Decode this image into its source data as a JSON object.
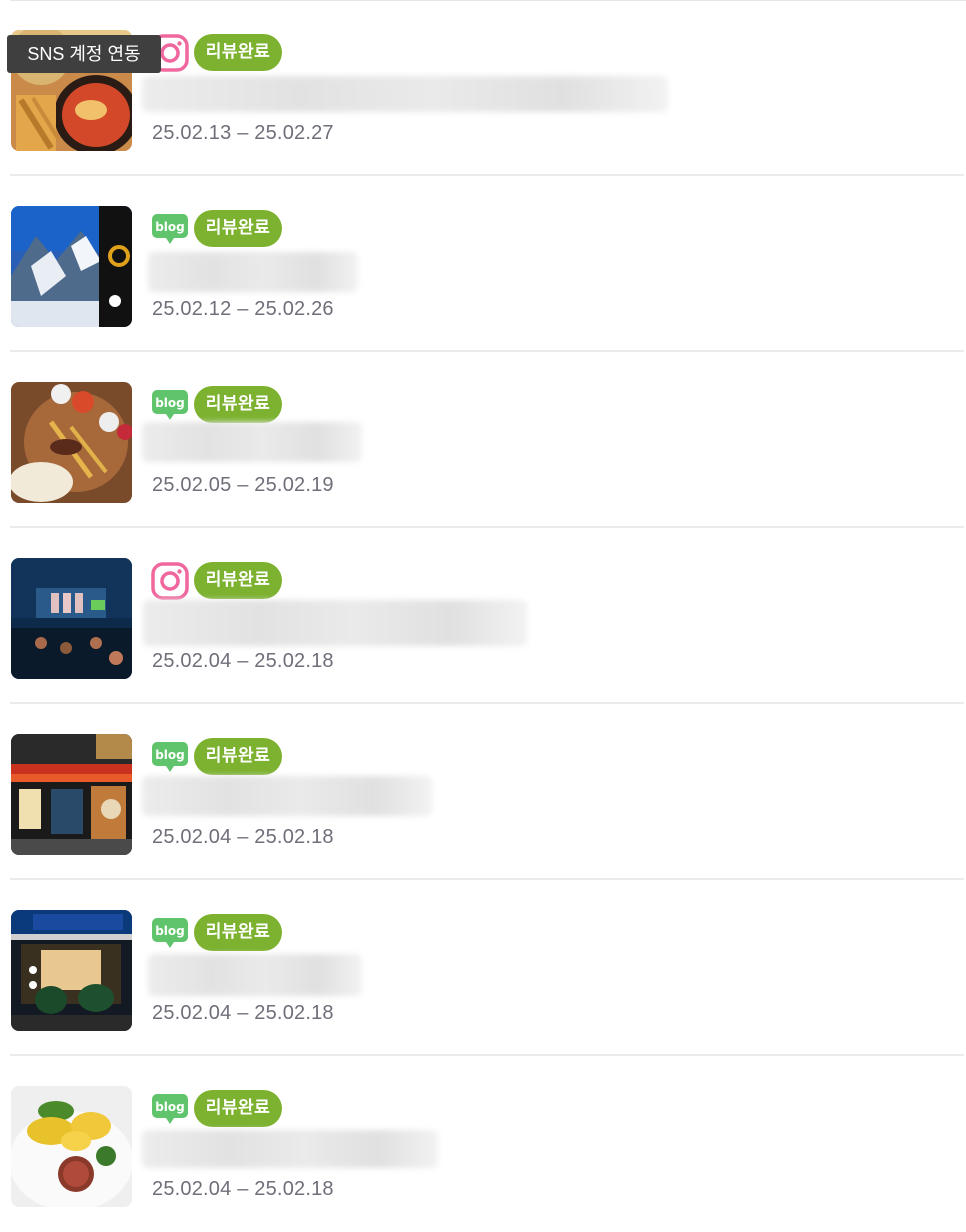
{
  "tooltip": {
    "text": "SNS 계정 연동"
  },
  "badge_label": "리뷰완료",
  "icons": {
    "instagram": "instagram-icon",
    "blog": "naver-blog-icon"
  },
  "colors": {
    "badge_bg": "#7cb22f",
    "instagram_pink": "#f0679e",
    "blog_green": "#5fc46b",
    "date_text": "#6f6f7a",
    "tooltip_bg": "#3f3f3f"
  },
  "blog_icon_text": "blog",
  "items": [
    {
      "sns": "instagram",
      "status": "리뷰완료",
      "date_range": "25.02.13 – 25.02.27",
      "thumbnail": "food-stew-image"
    },
    {
      "sns": "blog",
      "status": "리뷰완료",
      "date_range": "25.02.12 – 25.02.26",
      "thumbnail": "snowy-mountain-image"
    },
    {
      "sns": "blog",
      "status": "리뷰완료",
      "date_range": "25.02.05 – 25.02.19",
      "thumbnail": "meat-platter-image"
    },
    {
      "sns": "instagram",
      "status": "리뷰완료",
      "date_range": "25.02.04 – 25.02.18",
      "thumbnail": "concert-stage-image"
    },
    {
      "sns": "blog",
      "status": "리뷰완료",
      "date_range": "25.02.04 – 25.02.18",
      "thumbnail": "restaurant-storefront-image"
    },
    {
      "sns": "blog",
      "status": "리뷰완료",
      "date_range": "25.02.04 – 25.02.18",
      "thumbnail": "chinese-restaurant-image"
    },
    {
      "sns": "blog",
      "status": "리뷰완료",
      "date_range": "25.02.04 – 25.02.18",
      "thumbnail": "eggs-benedict-image"
    }
  ]
}
